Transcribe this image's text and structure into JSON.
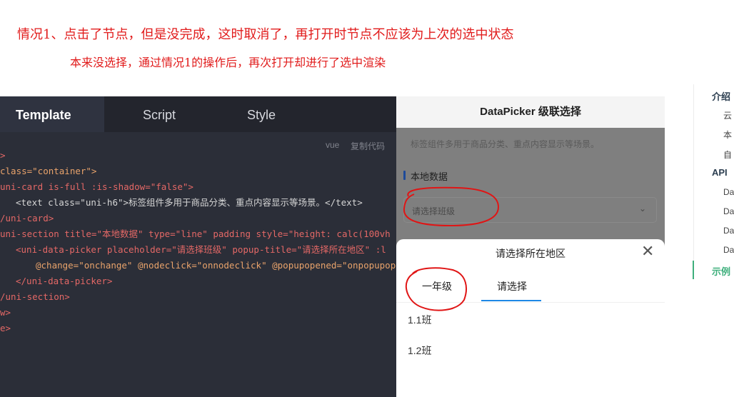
{
  "annotation": {
    "line1": "情况1、点击了节点，但是没完成，这时取消了，再打开时节点不应该为上次的选中状态",
    "line2": "本来没选择，通过情况1的操作后，再次打开却进行了选中渲染",
    "color": "#e11b1b"
  },
  "code_panel": {
    "tabs": [
      "Template",
      "Script",
      "Style"
    ],
    "active_tab": "Template",
    "meta_lang": "vue",
    "meta_copy": "复制代码",
    "lines": [
      ">",
      "class=\"container\">",
      "uni-card is-full :is-shadow=\"false\">",
      "<text class=\"uni-h6\">标签组件多用于商品分类、重点内容显示等场景。</text>",
      "/uni-card>",
      "uni-section title=\"本地数据\" type=\"line\" padding style=\"height: calc(100vh",
      "<uni-data-picker placeholder=\"请选择班级\" popup-title=\"请选择所在地区\" :l",
      "@change=\"onchange\" @nodeclick=\"onnodeclick\" @popupopened=\"onpopupope",
      "</uni-data-picker>",
      "/uni-section>",
      "w>",
      "e>"
    ]
  },
  "preview": {
    "header": "DataPicker 级联选择",
    "desc": "标签组件多用于商品分类、重点内容显示等场景。",
    "section_title": "本地数据",
    "placeholder": "请选择班级",
    "chevron_icon": "chevron-down-icon",
    "popup": {
      "title": "请选择所在地区",
      "close_icon": "close-icon",
      "tabs": [
        "一年级",
        "请选择"
      ],
      "items": [
        "1.1班",
        "1.2班"
      ]
    }
  },
  "sidenav": {
    "items": [
      "介绍",
      "云",
      "本",
      "自",
      "API",
      "Da",
      "Da",
      "Da",
      "Da",
      "示例"
    ]
  }
}
